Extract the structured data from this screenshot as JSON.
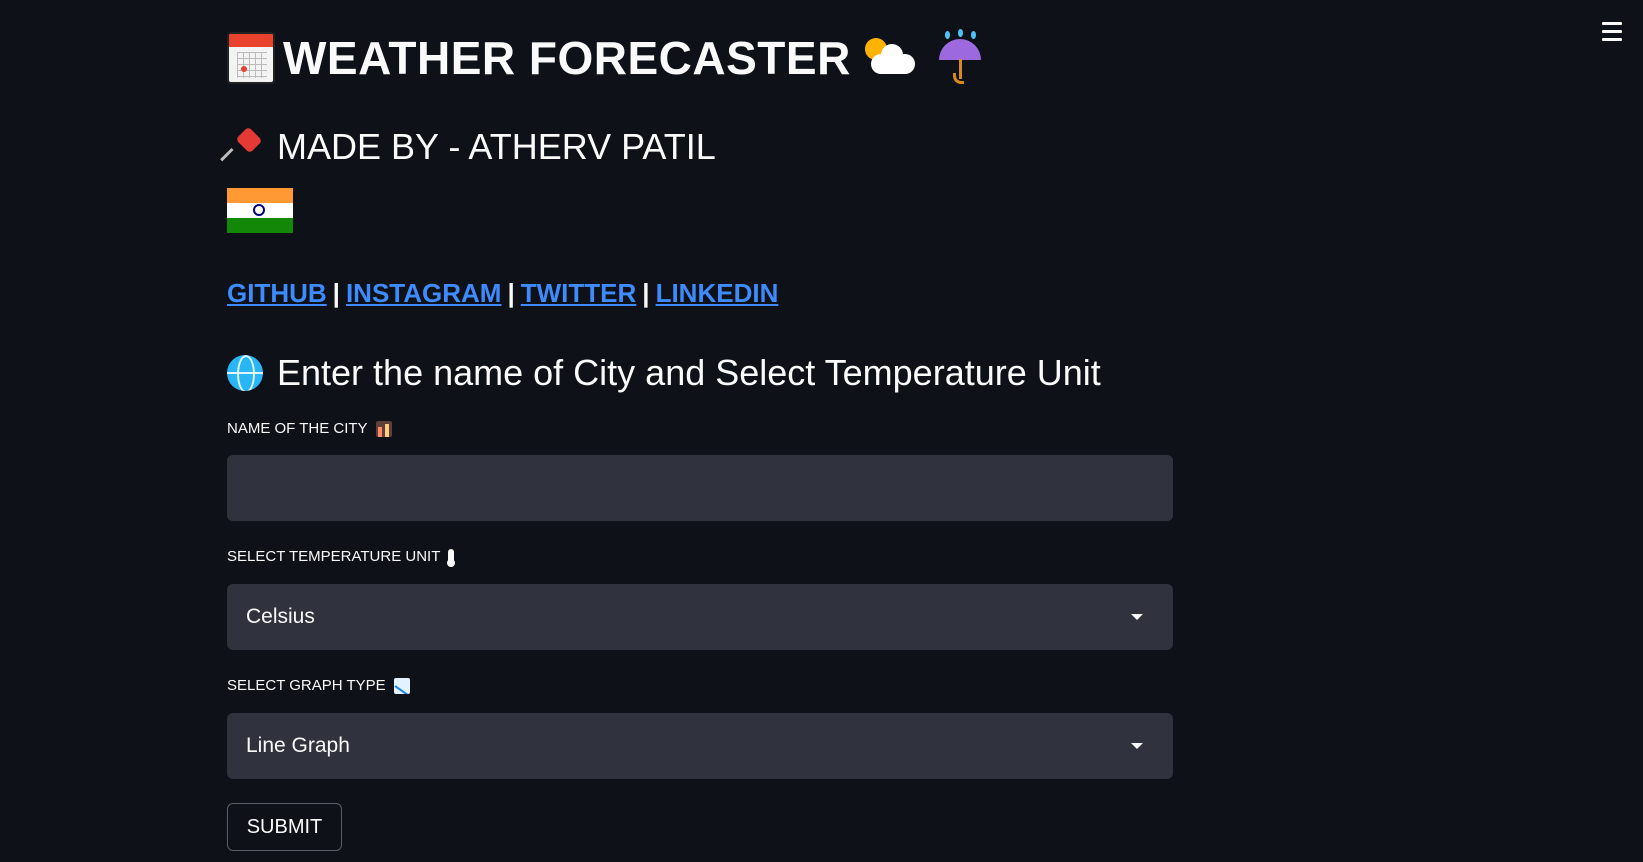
{
  "header": {
    "title": "WEATHER FORECASTER",
    "icons": [
      "calendar-icon",
      "sun-behind-cloud-icon",
      "umbrella-with-rain-icon"
    ]
  },
  "author": {
    "text": "MADE BY - ATHERV PATIL",
    "icons": [
      "pushpin-icon",
      "india-flag-icon"
    ]
  },
  "links": {
    "items": [
      "GITHUB",
      "INSTAGRAM",
      "TWITTER",
      "LINKEDIN"
    ],
    "separator": "|",
    "color": "#3d8bfd"
  },
  "section": {
    "heading": "Enter the name of City and Select Temperature Unit",
    "icon": "globe-icon"
  },
  "form": {
    "city_label": "NAME OF THE CITY",
    "city_value": "",
    "unit_label": "SELECT TEMPERATURE UNIT",
    "unit_value": "Celsius",
    "graph_label": "SELECT GRAPH TYPE",
    "graph_value": "Line Graph",
    "submit_label": "SUBMIT"
  },
  "theme": {
    "background": "#0e1117",
    "input_background": "#30323e",
    "text": "#fafafa"
  }
}
